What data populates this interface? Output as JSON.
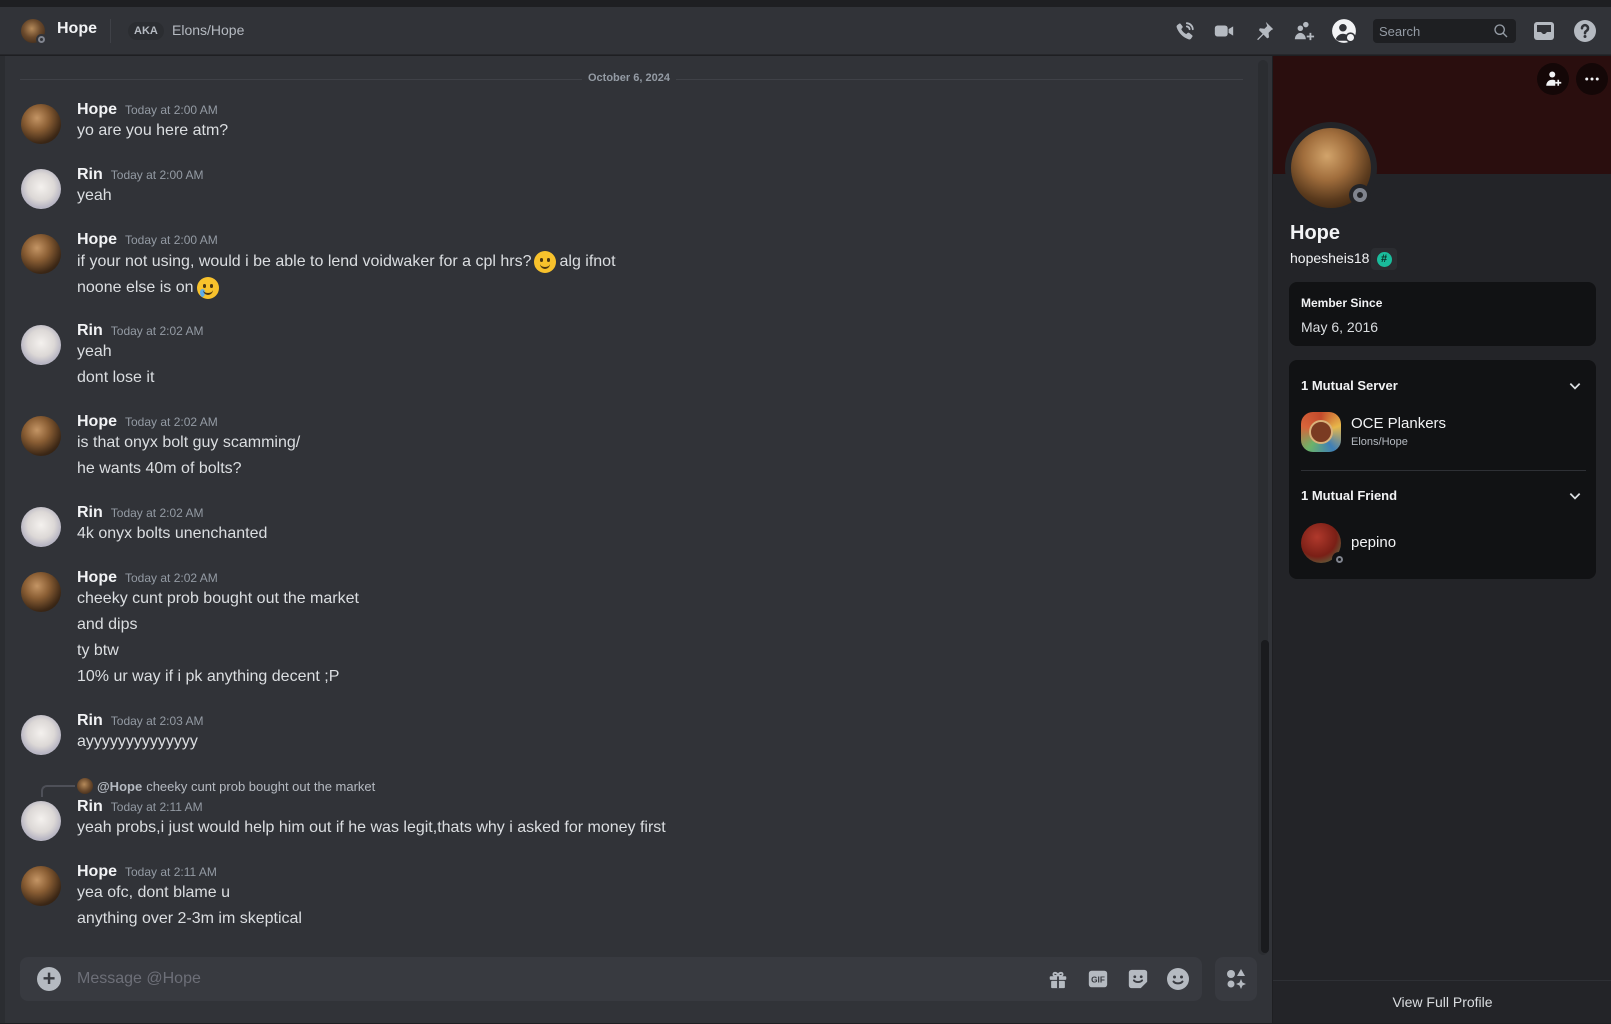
{
  "header": {
    "name": "Hope",
    "aka_label": "AKA",
    "alias": "Elons/Hope",
    "search_placeholder": "Search",
    "icons": [
      "voice-call-icon",
      "video-call-icon",
      "pin-icon",
      "add-friend-to-dm-icon",
      "user-profile-icon",
      "inbox-icon",
      "help-icon"
    ]
  },
  "chat": {
    "date_divider": "October 6, 2024",
    "groups": [
      {
        "author": "Hope",
        "timestamp": "Today at 2:00 AM",
        "lines": [
          "yo are you here atm?"
        ]
      },
      {
        "author": "Rin",
        "timestamp": "Today at 2:00 AM",
        "lines": [
          "yeah"
        ]
      },
      {
        "author": "Hope",
        "timestamp": "Today at 2:00 AM",
        "lines": [
          "if your not using, would i be able to lend voidwaker for a cpl hrs?",
          "alg ifnot",
          "noone else is on"
        ],
        "emojis": [
          "slightly-smiling-face",
          "smiling-face-with-tear"
        ]
      },
      {
        "author": "Rin",
        "timestamp": "Today at 2:02 AM",
        "lines": [
          "yeah",
          "dont lose it"
        ]
      },
      {
        "author": "Hope",
        "timestamp": "Today at 2:02 AM",
        "lines": [
          "is that onyx bolt guy scamming/",
          "he wants 40m of bolts?"
        ]
      },
      {
        "author": "Rin",
        "timestamp": "Today at 2:02 AM",
        "lines": [
          "4k onyx bolts unenchanted"
        ]
      },
      {
        "author": "Hope",
        "timestamp": "Today at 2:02 AM",
        "lines": [
          "cheeky cunt prob bought out the market",
          "and dips",
          "ty btw",
          "10% ur way if i pk anything decent ;P"
        ]
      },
      {
        "author": "Rin",
        "timestamp": "Today at 2:03 AM",
        "lines": [
          "ayyyyyyyyyyyyyy"
        ]
      },
      {
        "author": "Rin",
        "timestamp": "Today at 2:11 AM",
        "reply": {
          "mention": "@Hope",
          "text": "cheeky cunt prob bought out the market"
        },
        "lines": [
          "yeah probs,i just would help him out if he was legit,thats why i asked for money first"
        ]
      },
      {
        "author": "Hope",
        "timestamp": "Today at 2:11 AM",
        "lines": [
          "yea ofc, dont blame u",
          "anything over 2-3m im skeptical"
        ]
      }
    ]
  },
  "composer": {
    "placeholder": "Message @Hope",
    "value": "",
    "gif_label": "GIF"
  },
  "profile": {
    "display_name": "Hope",
    "username": "hopesheis18",
    "badge_glyph": "#",
    "member_since_label": "Member Since",
    "member_since": "May 6, 2016",
    "mutual_servers_label": "1 Mutual Server",
    "server_name": "OCE Plankers",
    "server_nickname": "Elons/Hope",
    "mutual_friends_label": "1 Mutual Friend",
    "friend_name": "pepino",
    "view_full_profile": "View Full Profile"
  },
  "colors": {
    "background": "#313338",
    "sidebar": "#232428",
    "banner": "#2a0e0e",
    "badge": "#1abc9c",
    "text": "#dbdee1",
    "muted": "#949ba4"
  }
}
